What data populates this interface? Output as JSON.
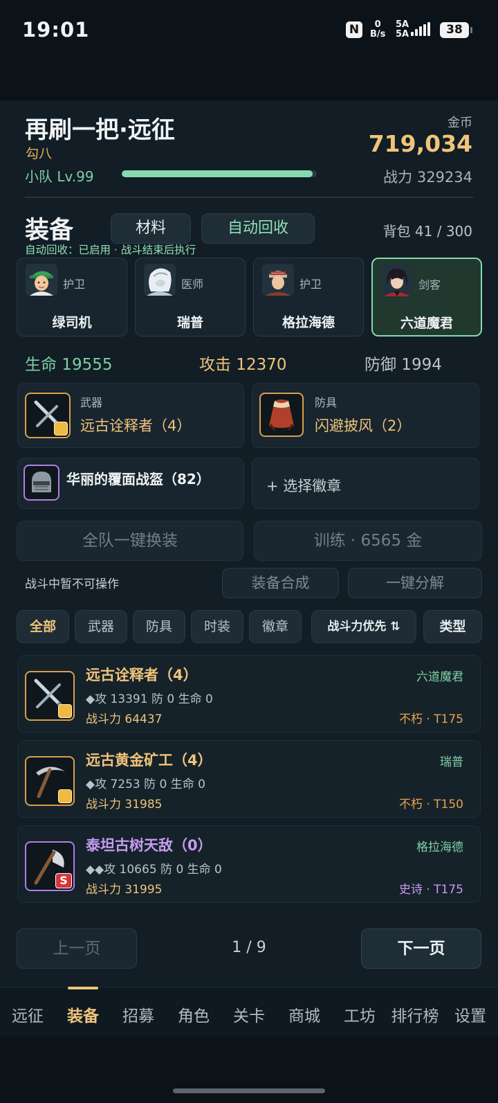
{
  "status_bar": {
    "time": "19:01",
    "net_speed_value": "0",
    "net_speed_unit": "B/s",
    "signal_label_1": "5A",
    "signal_label_2": "5A",
    "battery": "38",
    "nfc_label": "N"
  },
  "header": {
    "title": "再刷一把·远征",
    "subtitle": "勾八",
    "team_level": "小队 Lv.99",
    "xp_progress": 0.98,
    "gold_label": "金币",
    "gold_value": "719,034",
    "total_power": "战力 329234"
  },
  "equipment": {
    "section_title": "装备",
    "tab_materials": "材料",
    "tab_auto_recycle": "自动回收",
    "bag_count": "背包 41 / 300",
    "auto_recycle_info": "自动回收：已启用 · 战斗结束后执行"
  },
  "heroes": [
    {
      "role": "护卫",
      "name": "绿司机",
      "selected": false
    },
    {
      "role": "医师",
      "name": "瑞普",
      "selected": false
    },
    {
      "role": "护卫",
      "name": "格拉海德",
      "selected": false
    },
    {
      "role": "剑客",
      "name": "六道魔君",
      "selected": true
    }
  ],
  "stats": {
    "hp": "生命 19555",
    "atk": "攻击 12370",
    "def": "防御 1994"
  },
  "slots": {
    "weapon_type": "武器",
    "weapon_item": "远古诠释者（4）",
    "armor_type": "防具",
    "armor_item": "闪避披风（2）",
    "helmet_item": "华丽的覆面战盔（82）",
    "badge_select": "+ 选择徽章"
  },
  "actions": {
    "equip_all": "全队一键换装",
    "train": "训练 · 6565 金",
    "battle_note": "战斗中暂不可操作",
    "synthesize": "装备合成",
    "decompose": "一键分解"
  },
  "filters": {
    "all": "全部",
    "weapon": "武器",
    "armor": "防具",
    "fashion": "时装",
    "badge": "徽章",
    "sort": "战斗力优先 ⇅",
    "type": "类型"
  },
  "items": [
    {
      "name": "远古诠释者（4）",
      "stats": "◆攻 13391  防 0  生命 0",
      "power": "战斗力 64437",
      "owner": "六道魔君",
      "tier": "不朽 · T175",
      "rarity": "immortal"
    },
    {
      "name": "远古黄金矿工（4）",
      "stats": "◆攻 7253  防 0  生命 0",
      "power": "战斗力 31985",
      "owner": "瑞普",
      "tier": "不朽 · T150",
      "rarity": "immortal"
    },
    {
      "name": "泰坦古树天敌（0）",
      "stats": "◆◆攻 10665  防 0  生命 0",
      "power": "战斗力 31995",
      "owner": "格拉海德",
      "tier": "史诗 · T175",
      "rarity": "epic",
      "badge": "S"
    }
  ],
  "pagination": {
    "prev": "上一页",
    "indicator": "1 / 9",
    "next": "下一页"
  },
  "nav": [
    "远征",
    "装备",
    "招募",
    "角色",
    "关卡",
    "商城",
    "工坊",
    "排行榜",
    "设置"
  ],
  "colors": {
    "accent_gold": "#f0c47a",
    "accent_green": "#86d8b0",
    "epic_purple": "#c79bf2",
    "background": "#121d25"
  }
}
